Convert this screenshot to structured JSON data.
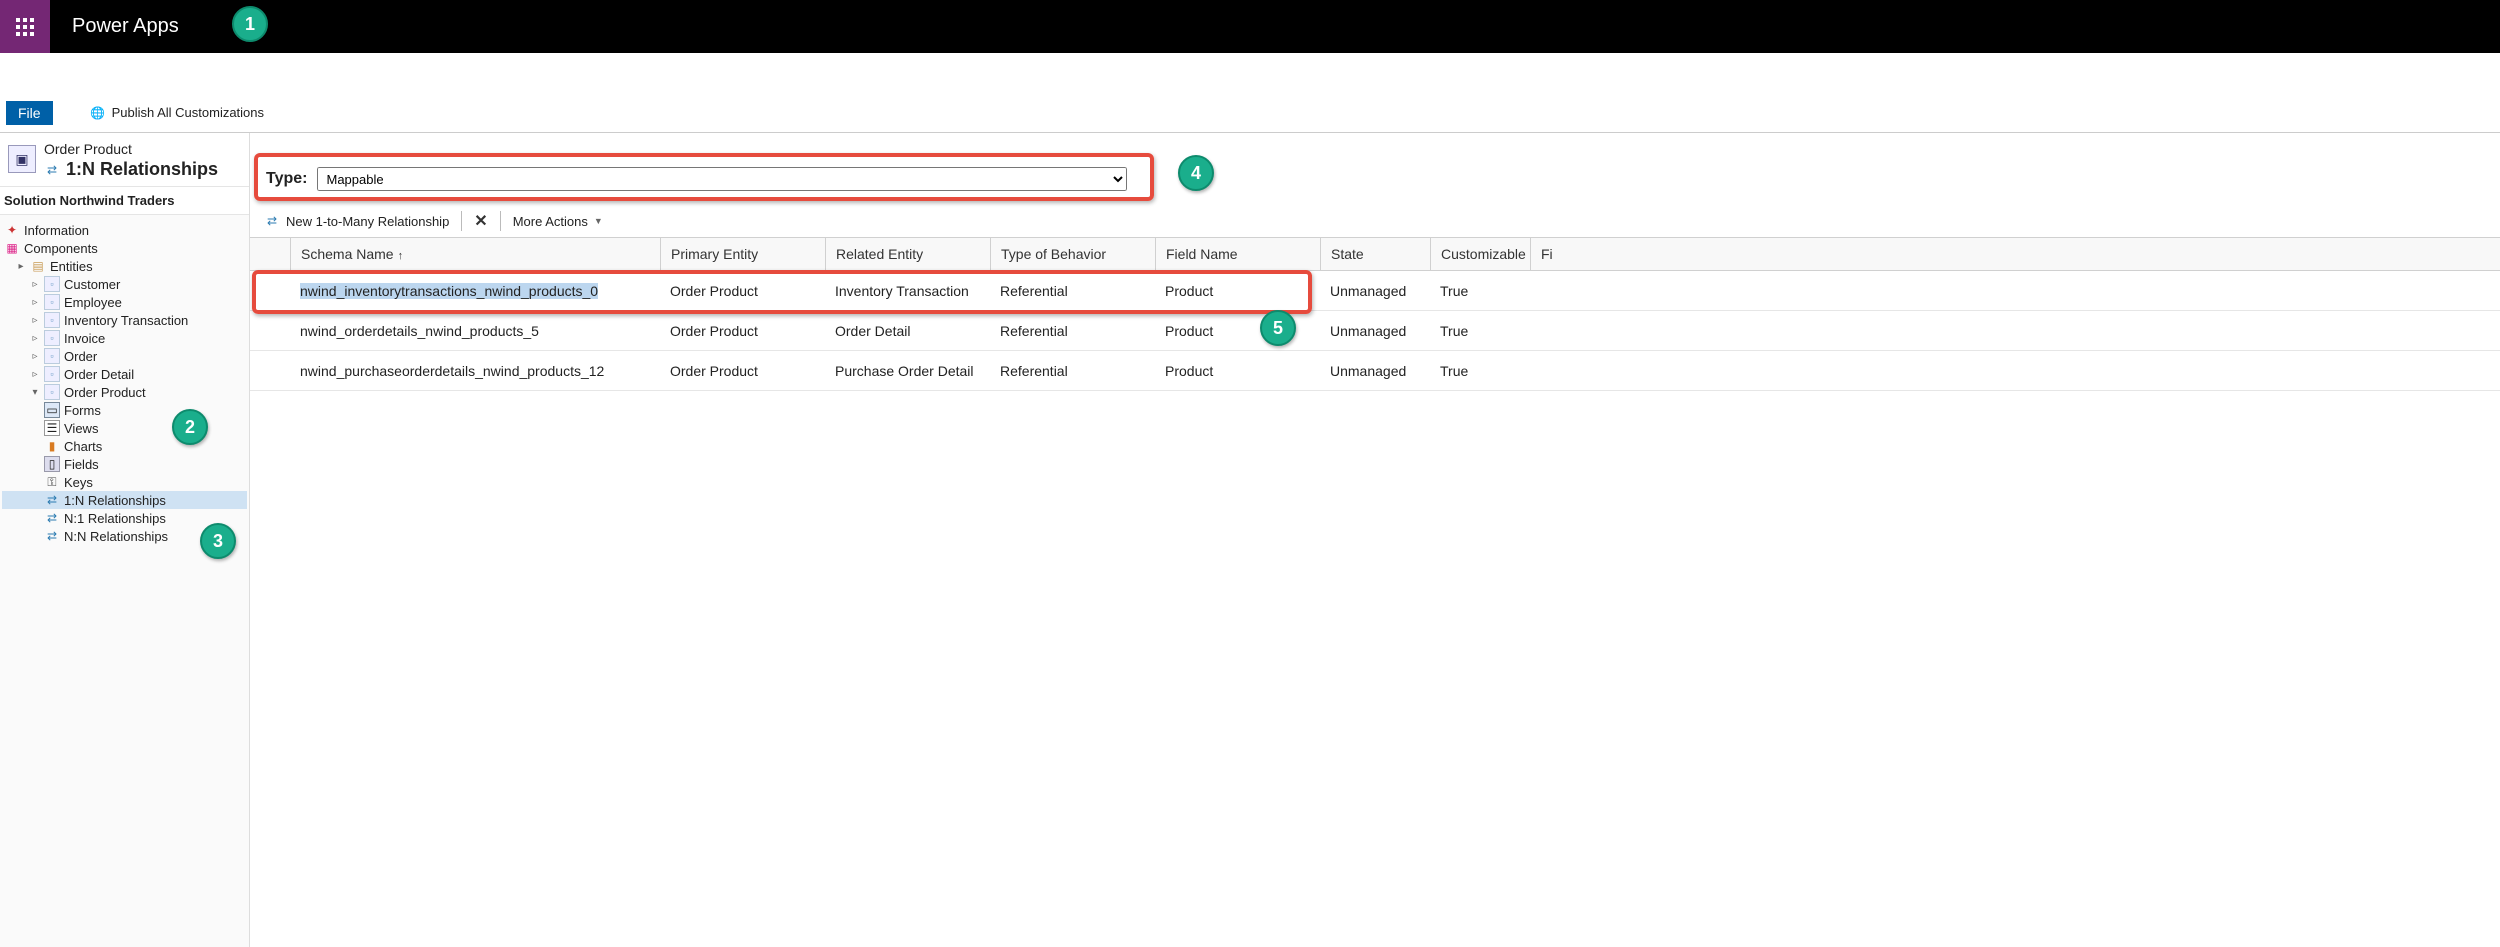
{
  "header": {
    "app_title": "Power Apps"
  },
  "toolbar": {
    "file": "File",
    "publish_all": "Publish All Customizations"
  },
  "entity_header": {
    "name": "Order Product",
    "subtitle": "1:N Relationships"
  },
  "solution": {
    "prefix": "Solution",
    "name": "Northwind Traders"
  },
  "tree": {
    "information": "Information",
    "components": "Components",
    "entities": "Entities",
    "entity_items": [
      "Customer",
      "Employee",
      "Inventory Transaction",
      "Invoice",
      "Order",
      "Order Detail",
      "Order Product"
    ],
    "sub_items": [
      "Forms",
      "Views",
      "Charts",
      "Fields",
      "Keys",
      "1:N Relationships",
      "N:1 Relationships",
      "N:N Relationships"
    ]
  },
  "filter": {
    "label": "Type:",
    "selected": "Mappable"
  },
  "cmd": {
    "new": "New 1-to-Many Relationship",
    "more": "More Actions"
  },
  "grid": {
    "headers": [
      "Schema Name",
      "Primary Entity",
      "Related Entity",
      "Type of Behavior",
      "Field Name",
      "State",
      "Customizable",
      "Fi"
    ],
    "rows": [
      {
        "schema": "nwind_inventorytransactions_nwind_products_0",
        "primary": "Order Product",
        "related": "Inventory Transaction",
        "behavior": "Referential",
        "field": "Product",
        "state": "Unmanaged",
        "custom": "True"
      },
      {
        "schema": "nwind_orderdetails_nwind_products_5",
        "primary": "Order Product",
        "related": "Order Detail",
        "behavior": "Referential",
        "field": "Product",
        "state": "Unmanaged",
        "custom": "True"
      },
      {
        "schema": "nwind_purchaseorderdetails_nwind_products_12",
        "primary": "Order Product",
        "related": "Purchase Order Detail",
        "behavior": "Referential",
        "field": "Product",
        "state": "Unmanaged",
        "custom": "True"
      }
    ]
  },
  "badges": {
    "b1": "1",
    "b2": "2",
    "b3": "3",
    "b4": "4",
    "b5": "5"
  }
}
